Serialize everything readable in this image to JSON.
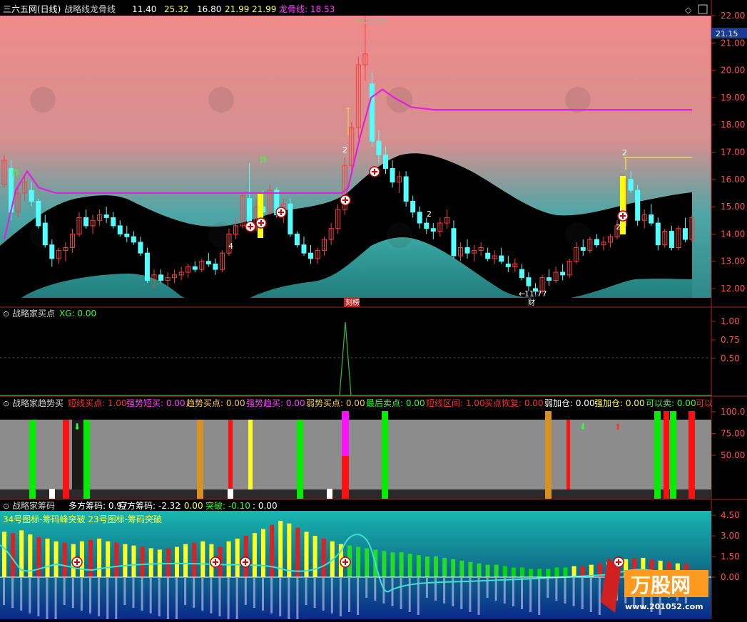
{
  "panel1": {
    "title": "三六五网(日线)",
    "indicator": "战略线龙骨线",
    "values": [
      "11.40",
      "25.32",
      "16.80",
      "21.99",
      "21.99"
    ],
    "dragon_label": "龙骨线: 18.53",
    "ticks": [
      "22.00",
      "21.00",
      "20.00",
      "19.00",
      "18.00",
      "17.00",
      "16.00",
      "15.00",
      "14.00",
      "13.00",
      "12.00"
    ],
    "current_price": "21.15",
    "high_label": "21.99",
    "low_label": "11.77",
    "zha": "炸",
    "marker_2": "2",
    "marker_4": "4",
    "bottom_tag_left": "刻榜",
    "bottom_tag_right": "财"
  },
  "panel2": {
    "title": "战略家买点",
    "xg": "XG: 0.00",
    "ticks": [
      "1.00",
      "0.75",
      "0.50"
    ]
  },
  "panel3": {
    "title": "战略家趋势买",
    "labels": [
      {
        "t": "短线买点: 1.00",
        "c": "#ff3030"
      },
      {
        "t": "强势短买: 0.00",
        "c": "#ff40ff"
      },
      {
        "t": "趋势买点: 0.00",
        "c": "#ffcc44"
      },
      {
        "t": "强势趋买: 0.00",
        "c": "#ff40ff"
      },
      {
        "t": "弱势买点: 0.00",
        "c": "#ffcc44"
      },
      {
        "t": "最后卖点: 0.00",
        "c": "#30ff30"
      },
      {
        "t": "短线区间: 1.00",
        "c": "#ff3030"
      },
      {
        "t": "买点恢复: 0.00",
        "c": "#ff3030"
      },
      {
        "t": "弱加仓: 0.00",
        "c": "#ffffff"
      },
      {
        "t": "强加仓: 0.00",
        "c": "#ffff40"
      },
      {
        "t": "可以卖: 0.00",
        "c": "#30ff30"
      },
      {
        "t": "可以",
        "c": "#ff3030"
      }
    ],
    "ticks": [
      "100.0",
      "75.00",
      "50.00"
    ]
  },
  "panel4": {
    "title": "战略家筹码",
    "long": "多方筹码: 0.97",
    "short": "空方筹码: -2.32",
    "zero": ": 0.00",
    "breakout": "突破: -0.10",
    "last": ": 0.00",
    "subtitle": "34号图标-筹码峰突破 23号图标-筹码突破",
    "ticks": [
      "4.50",
      "3.00",
      "1.50",
      "0.00"
    ]
  },
  "watermark": {
    "brand": "万股网",
    "url": "www.201052.com"
  },
  "colors": {
    "up": "#ff3c3c",
    "down": "#54ffff",
    "dragon": "#e020e0",
    "yellow": "#ffff00",
    "green": "#00ff00"
  },
  "chart_data": {
    "type": "line",
    "candles": [
      [
        15.8,
        16.9,
        15.7,
        16.7
      ],
      [
        16.4,
        16.7,
        14.5,
        14.8
      ],
      [
        14.8,
        15.7,
        14.6,
        15.5
      ],
      [
        15.5,
        16.1,
        15.2,
        15.9
      ],
      [
        15.6,
        15.9,
        15.0,
        15.2
      ],
      [
        15.2,
        15.3,
        14.2,
        14.3
      ],
      [
        14.4,
        14.7,
        13.5,
        13.6
      ],
      [
        13.6,
        13.8,
        12.8,
        13.1
      ],
      [
        13.1,
        13.5,
        12.9,
        13.4
      ],
      [
        13.4,
        13.7,
        13.0,
        13.5
      ],
      [
        13.5,
        14.2,
        13.3,
        14.0
      ],
      [
        14.0,
        14.8,
        13.9,
        14.6
      ],
      [
        14.6,
        14.9,
        14.2,
        14.3
      ],
      [
        14.3,
        14.7,
        14.0,
        14.5
      ],
      [
        14.5,
        14.9,
        14.3,
        14.7
      ],
      [
        14.7,
        15.0,
        14.4,
        14.6
      ],
      [
        14.6,
        14.8,
        14.2,
        14.3
      ],
      [
        14.3,
        14.5,
        13.9,
        14.0
      ],
      [
        14.0,
        14.3,
        13.7,
        13.9
      ],
      [
        13.9,
        14.1,
        13.6,
        13.7
      ],
      [
        13.7,
        13.9,
        13.2,
        13.3
      ],
      [
        13.3,
        13.5,
        12.2,
        12.3
      ],
      [
        12.3,
        12.7,
        12.0,
        12.5
      ],
      [
        12.5,
        12.7,
        12.2,
        12.3
      ],
      [
        12.3,
        12.6,
        12.1,
        12.4
      ],
      [
        12.4,
        12.7,
        12.2,
        12.5
      ],
      [
        12.5,
        12.8,
        12.3,
        12.6
      ],
      [
        12.6,
        12.9,
        12.4,
        12.8
      ],
      [
        12.8,
        13.0,
        12.6,
        12.7
      ],
      [
        12.7,
        13.1,
        12.6,
        13.0
      ],
      [
        13.0,
        13.3,
        12.8,
        12.9
      ],
      [
        12.9,
        13.1,
        12.5,
        12.7
      ],
      [
        12.7,
        13.4,
        12.6,
        13.3
      ],
      [
        13.3,
        14.2,
        13.2,
        14.0
      ],
      [
        14.0,
        14.6,
        13.8,
        14.3
      ],
      [
        14.3,
        15.5,
        14.2,
        15.4
      ],
      [
        15.3,
        16.6,
        14.2,
        14.3
      ],
      [
        14.3,
        15.3,
        14.1,
        15.0
      ],
      [
        15.0,
        15.6,
        14.6,
        14.8
      ],
      [
        14.8,
        15.8,
        14.7,
        15.6
      ],
      [
        15.6,
        15.7,
        14.6,
        14.7
      ],
      [
        14.7,
        15.3,
        14.4,
        15.1
      ],
      [
        15.1,
        15.3,
        13.9,
        14.0
      ],
      [
        14.0,
        14.1,
        13.5,
        13.6
      ],
      [
        13.6,
        13.9,
        13.2,
        13.3
      ],
      [
        13.3,
        13.6,
        12.9,
        13.1
      ],
      [
        13.1,
        13.5,
        12.9,
        13.4
      ],
      [
        13.4,
        13.9,
        13.2,
        13.8
      ],
      [
        13.8,
        14.4,
        13.6,
        14.2
      ],
      [
        14.2,
        15.1,
        14.0,
        14.9
      ],
      [
        14.9,
        16.8,
        14.7,
        16.5
      ],
      [
        16.5,
        18.1,
        16.3,
        17.9
      ],
      [
        17.9,
        20.5,
        17.5,
        20.2
      ],
      [
        20.2,
        21.99,
        19.6,
        20.6
      ],
      [
        19.5,
        19.9,
        17.2,
        17.4
      ],
      [
        17.4,
        17.8,
        16.6,
        16.9
      ],
      [
        16.9,
        17.2,
        16.2,
        16.4
      ],
      [
        16.4,
        16.7,
        15.7,
        15.9
      ],
      [
        15.9,
        16.3,
        15.5,
        16.1
      ],
      [
        16.1,
        16.3,
        15.0,
        15.2
      ],
      [
        15.2,
        15.4,
        14.6,
        14.8
      ],
      [
        14.8,
        15.0,
        14.2,
        14.4
      ],
      [
        14.4,
        14.6,
        14.0,
        14.2
      ],
      [
        14.2,
        14.4,
        13.8,
        14.1
      ],
      [
        14.1,
        14.6,
        13.9,
        14.4
      ],
      [
        14.4,
        14.9,
        14.2,
        14.6
      ],
      [
        14.2,
        14.5,
        13.1,
        13.2
      ],
      [
        13.2,
        13.7,
        13.0,
        13.5
      ],
      [
        13.5,
        13.8,
        13.1,
        13.3
      ],
      [
        13.3,
        13.6,
        13.0,
        13.4
      ],
      [
        13.4,
        13.7,
        13.2,
        13.5
      ],
      [
        13.3,
        13.5,
        13.0,
        13.1
      ],
      [
        13.1,
        13.4,
        12.9,
        13.2
      ],
      [
        13.2,
        13.5,
        12.9,
        13.0
      ],
      [
        12.9,
        13.2,
        12.6,
        12.8
      ],
      [
        12.8,
        13.1,
        12.6,
        12.9
      ],
      [
        12.7,
        12.9,
        12.3,
        12.4
      ],
      [
        12.4,
        12.6,
        11.9,
        12.1
      ],
      [
        12.0,
        12.2,
        11.77,
        11.9
      ],
      [
        11.9,
        12.5,
        11.8,
        12.4
      ],
      [
        12.4,
        12.7,
        12.1,
        12.3
      ],
      [
        12.3,
        12.8,
        12.2,
        12.6
      ],
      [
        12.6,
        12.9,
        12.3,
        12.5
      ],
      [
        12.5,
        13.1,
        12.4,
        13.0
      ],
      [
        13.0,
        13.7,
        12.9,
        13.5
      ],
      [
        13.5,
        13.8,
        13.2,
        13.4
      ],
      [
        13.4,
        13.9,
        13.3,
        13.8
      ],
      [
        13.8,
        14.0,
        13.5,
        13.6
      ],
      [
        13.6,
        13.9,
        13.4,
        13.7
      ],
      [
        13.7,
        14.0,
        13.5,
        13.9
      ],
      [
        13.9,
        14.5,
        13.8,
        14.3
      ],
      [
        14.3,
        16.1,
        14.2,
        16.0
      ],
      [
        16.0,
        16.3,
        15.5,
        15.6
      ],
      [
        15.6,
        15.8,
        14.3,
        14.5
      ],
      [
        14.5,
        14.9,
        14.2,
        14.7
      ],
      [
        14.7,
        15.1,
        14.3,
        14.4
      ],
      [
        14.4,
        14.6,
        13.4,
        13.6
      ],
      [
        13.6,
        14.2,
        13.5,
        14.1
      ],
      [
        14.1,
        14.3,
        13.4,
        13.5
      ],
      [
        13.5,
        14.3,
        13.4,
        14.2
      ],
      [
        14.2,
        14.6,
        13.7,
        13.8
      ],
      [
        13.8,
        14.7,
        13.7,
        14.6
      ]
    ],
    "dragon_line": [
      [
        0,
        13.8
      ],
      [
        4,
        15.6
      ],
      [
        8,
        16.3
      ],
      [
        12,
        15.7
      ],
      [
        18,
        15.5
      ],
      [
        50,
        15.5
      ],
      [
        100,
        15.5
      ],
      [
        118,
        15.5
      ],
      [
        120,
        15.7
      ],
      [
        124,
        17.5
      ],
      [
        128,
        19.0
      ],
      [
        132,
        19.3
      ],
      [
        136,
        19.0
      ],
      [
        142,
        18.65
      ],
      [
        150,
        18.55
      ],
      [
        240,
        18.55
      ]
    ],
    "xg_signal": [
      0,
      0,
      0,
      0,
      0,
      0,
      1,
      0,
      0,
      0,
      0,
      0
    ],
    "volume_bars": [
      3.3,
      3.2,
      3.4,
      3.1,
      2.9,
      2.8,
      2.6,
      2.5,
      2.4,
      2.6,
      2.7,
      2.8,
      2.6,
      2.5,
      2.4,
      2.3,
      2.2,
      2.1,
      2.0,
      2.1,
      2.2,
      2.4,
      2.5,
      2.6,
      2.4,
      2.2,
      2.6,
      2.8,
      3.0,
      3.2,
      3.5,
      3.8,
      4.1,
      3.9,
      3.6,
      3.3,
      3.0,
      2.8,
      2.6,
      2.4,
      2.3,
      2.2,
      2.1,
      2.0,
      1.9,
      1.8,
      1.8,
      1.7,
      1.6,
      1.5,
      1.5,
      1.4,
      1.3,
      1.2,
      1.1,
      1.0,
      0.9,
      0.9,
      0.8,
      0.7,
      0.7,
      0.6,
      0.6,
      0.6,
      0.7,
      0.7,
      0.8,
      0.8,
      0.9,
      1.0,
      1.1,
      1.2,
      1.3,
      1.4,
      1.4,
      1.3,
      1.2,
      1.1,
      1.0,
      1.0
    ]
  }
}
